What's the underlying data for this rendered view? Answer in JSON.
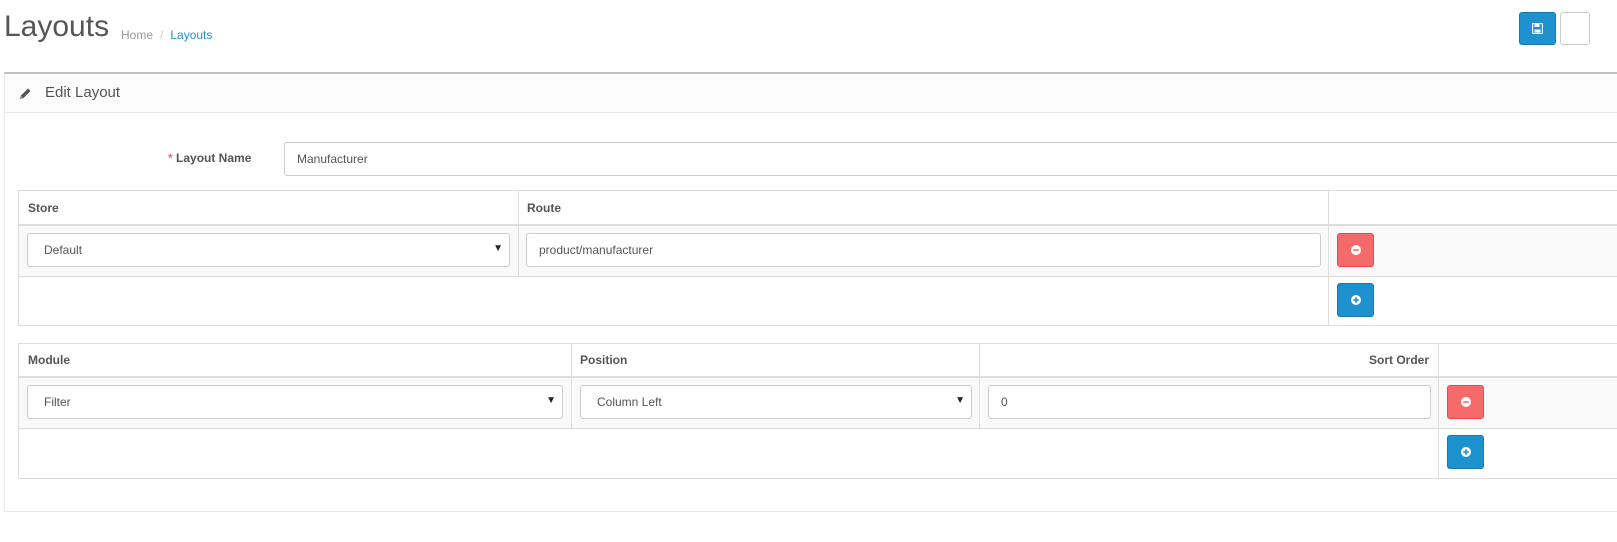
{
  "header": {
    "title": "Layouts",
    "breadcrumb": [
      {
        "label": "Home"
      },
      {
        "label": "Layouts"
      }
    ],
    "separator": "/"
  },
  "panel": {
    "title": "Edit Layout",
    "icon": "pencil-icon"
  },
  "form": {
    "layout_name_label": "Layout Name",
    "required_mark": "*",
    "layout_name_value": "Manufacturer"
  },
  "route_table": {
    "headers": {
      "store": "Store",
      "route": "Route"
    },
    "rows": [
      {
        "store": "Default",
        "route": "product/manufacturer"
      }
    ]
  },
  "module_table": {
    "headers": {
      "module": "Module",
      "position": "Position",
      "sort_order": "Sort Order"
    },
    "rows": [
      {
        "module": "Filter",
        "position": "Column Left",
        "sort_order": "0"
      }
    ]
  },
  "colors": {
    "primary": "#1e91cf",
    "danger": "#f56b6b"
  }
}
